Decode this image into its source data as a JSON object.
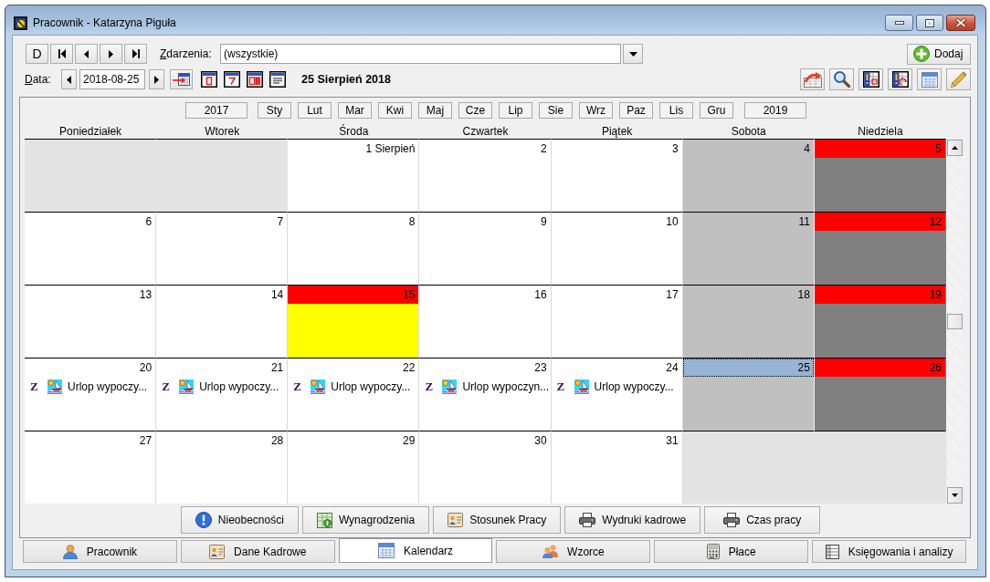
{
  "window": {
    "title": "Pracownik - Katarzyna Piguła"
  },
  "toolbar": {
    "today_button": "D",
    "events_label": "Zdarzenia:",
    "events_value": "(wszystkie)",
    "add_button": "Dodaj",
    "date_label": "Data:",
    "date_value": "2018-08-25",
    "date_caption": "25 Sierpień 2018"
  },
  "calendar": {
    "prev_year": "2017",
    "months": [
      "Sty",
      "Lut",
      "Mar",
      "Kwi",
      "Maj",
      "Cze",
      "Lip",
      "Sie",
      "Wrz",
      "Paz",
      "Lis",
      "Gru"
    ],
    "next_year": "2019",
    "weekdays": [
      "Poniedziałek",
      "Wtorek",
      "Środa",
      "Czwartek",
      "Piątek",
      "Sobota",
      "Niedziela"
    ],
    "weeks": [
      [
        {
          "kind": "outside",
          "selected": false
        },
        {
          "kind": "outside",
          "selected": false
        },
        {
          "kind": "weekday",
          "label": "1 Sierpień",
          "selected": false
        },
        {
          "kind": "weekday",
          "label": "2",
          "selected": false
        },
        {
          "kind": "weekday",
          "label": "3",
          "selected": false
        },
        {
          "kind": "saturday",
          "label": "4",
          "selected": false
        },
        {
          "kind": "sunday",
          "label": "5",
          "selected": false
        }
      ],
      [
        {
          "kind": "weekday",
          "label": "6",
          "selected": false
        },
        {
          "kind": "weekday",
          "label": "7",
          "selected": false
        },
        {
          "kind": "weekday",
          "label": "8",
          "selected": false
        },
        {
          "kind": "weekday",
          "label": "9",
          "selected": false
        },
        {
          "kind": "weekday",
          "label": "10",
          "selected": false
        },
        {
          "kind": "saturday",
          "label": "11",
          "selected": false
        },
        {
          "kind": "sunday",
          "label": "12",
          "selected": false
        }
      ],
      [
        {
          "kind": "weekday",
          "label": "13",
          "selected": false
        },
        {
          "kind": "weekday",
          "label": "14",
          "selected": false
        },
        {
          "kind": "holiday",
          "label": "15",
          "selected": false
        },
        {
          "kind": "weekday",
          "label": "16",
          "selected": false
        },
        {
          "kind": "weekday",
          "label": "17",
          "selected": false
        },
        {
          "kind": "saturday",
          "label": "18",
          "selected": false
        },
        {
          "kind": "sunday",
          "label": "19",
          "selected": false
        }
      ],
      [
        {
          "kind": "weekday",
          "label": "20",
          "selected": false,
          "events": [
            {
              "marker": "Z",
              "title": "Urlop wypoczy..."
            }
          ]
        },
        {
          "kind": "weekday",
          "label": "21",
          "selected": false,
          "events": [
            {
              "marker": "Z",
              "title": "Urlop wypoczy..."
            }
          ]
        },
        {
          "kind": "weekday",
          "label": "22",
          "selected": false,
          "events": [
            {
              "marker": "Z",
              "title": "Urlop wypoczy..."
            }
          ]
        },
        {
          "kind": "weekday",
          "label": "23",
          "selected": false,
          "events": [
            {
              "marker": "Z",
              "title": "Urlop wypoczyn..."
            }
          ]
        },
        {
          "kind": "weekday",
          "label": "24",
          "selected": false,
          "events": [
            {
              "marker": "Z",
              "title": "Urlop wypoczy..."
            }
          ]
        },
        {
          "kind": "saturday",
          "label": "25",
          "selected": true
        },
        {
          "kind": "sunday",
          "label": "26",
          "selected": false
        }
      ],
      [
        {
          "kind": "weekday",
          "label": "27",
          "selected": false
        },
        {
          "kind": "weekday",
          "label": "28",
          "selected": false
        },
        {
          "kind": "weekday",
          "label": "29",
          "selected": false
        },
        {
          "kind": "weekday",
          "label": "30",
          "selected": false
        },
        {
          "kind": "weekday",
          "label": "31",
          "selected": false
        },
        {
          "kind": "outside",
          "selected": false
        },
        {
          "kind": "outside",
          "selected": false
        }
      ]
    ]
  },
  "action_buttons": [
    {
      "label": "Nieobecności",
      "kind": "alert"
    },
    {
      "label": "Wynagrodzenia",
      "kind": "money"
    },
    {
      "label": "Stosunek Pracy",
      "kind": "id_card"
    },
    {
      "label": "Wydruki kadrowe",
      "kind": "printer"
    },
    {
      "label": "Czas pracy",
      "kind": "printer"
    }
  ],
  "tabs": [
    {
      "label": "Pracownik",
      "kind": "person",
      "selected": false
    },
    {
      "label": "Dane Kadrowe",
      "kind": "id_card",
      "selected": false
    },
    {
      "label": "Kalendarz",
      "kind": "calendar",
      "selected": true
    },
    {
      "label": "Wzorce",
      "kind": "people",
      "selected": false
    },
    {
      "label": "Płace",
      "kind": "calculator",
      "selected": false
    },
    {
      "label": "Księgowania i analizy",
      "kind": "ledger",
      "selected": false
    }
  ]
}
